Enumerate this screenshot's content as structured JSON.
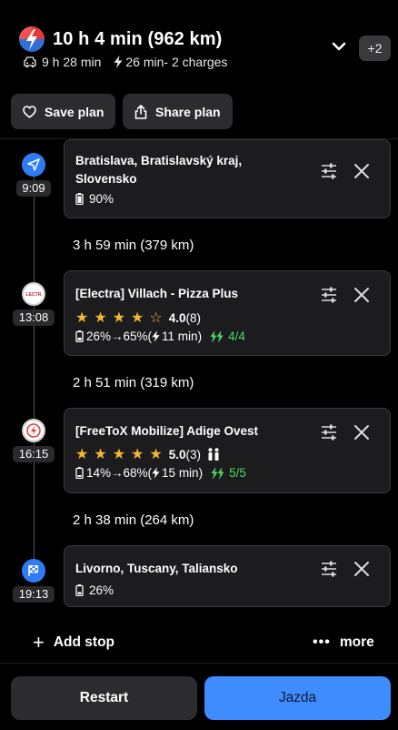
{
  "header": {
    "title": "10 h 4 min (962 km)",
    "drive_time": "9 h 28 min",
    "charge_summary": "26 min- 2 charges",
    "extra_count": "+2"
  },
  "actions": {
    "save_label": "Save plan",
    "share_label": "Share plan"
  },
  "stops": [
    {
      "time": "9:09",
      "name_line1": "Bratislava, Bratislavský kraj,",
      "name_line2": "Slovensko",
      "battery": "90%",
      "marker": "navigation-arrow-icon"
    },
    {
      "time": "13:08",
      "name": "[Electra] Villach - Pizza Plus",
      "stars": 4.0,
      "rating": "4.0",
      "reviews": "(8)",
      "charge": "26%→65%(",
      "charge_time": "11 min)",
      "plugs": "4/4",
      "marker": "electra-logo-icon"
    },
    {
      "time": "16:15",
      "name": "[FreeToX Mobilize] Adige Ovest",
      "stars": 5.0,
      "rating": "5.0",
      "reviews": "(3)",
      "charge": "14%→68%(",
      "charge_time": "15 min)",
      "plugs": "5/5",
      "marker": "freetox-logo-icon"
    },
    {
      "time": "19:13",
      "name": "Livorno, Tuscany, Taliansko",
      "battery": "26%",
      "marker": "finish-flag-icon"
    }
  ],
  "segments": [
    "3 h 59 min (379 km)",
    "2 h 51 min (319 km)",
    "2 h 38 min (264 km)"
  ],
  "footer": {
    "add_stop": "Add stop",
    "more": "more",
    "restart": "Restart",
    "drive": "Jazda"
  },
  "colors": {
    "accent_blue": "#3f8cff",
    "green": "#4cd964",
    "star": "#f5b731",
    "card": "#1c1c1e"
  }
}
